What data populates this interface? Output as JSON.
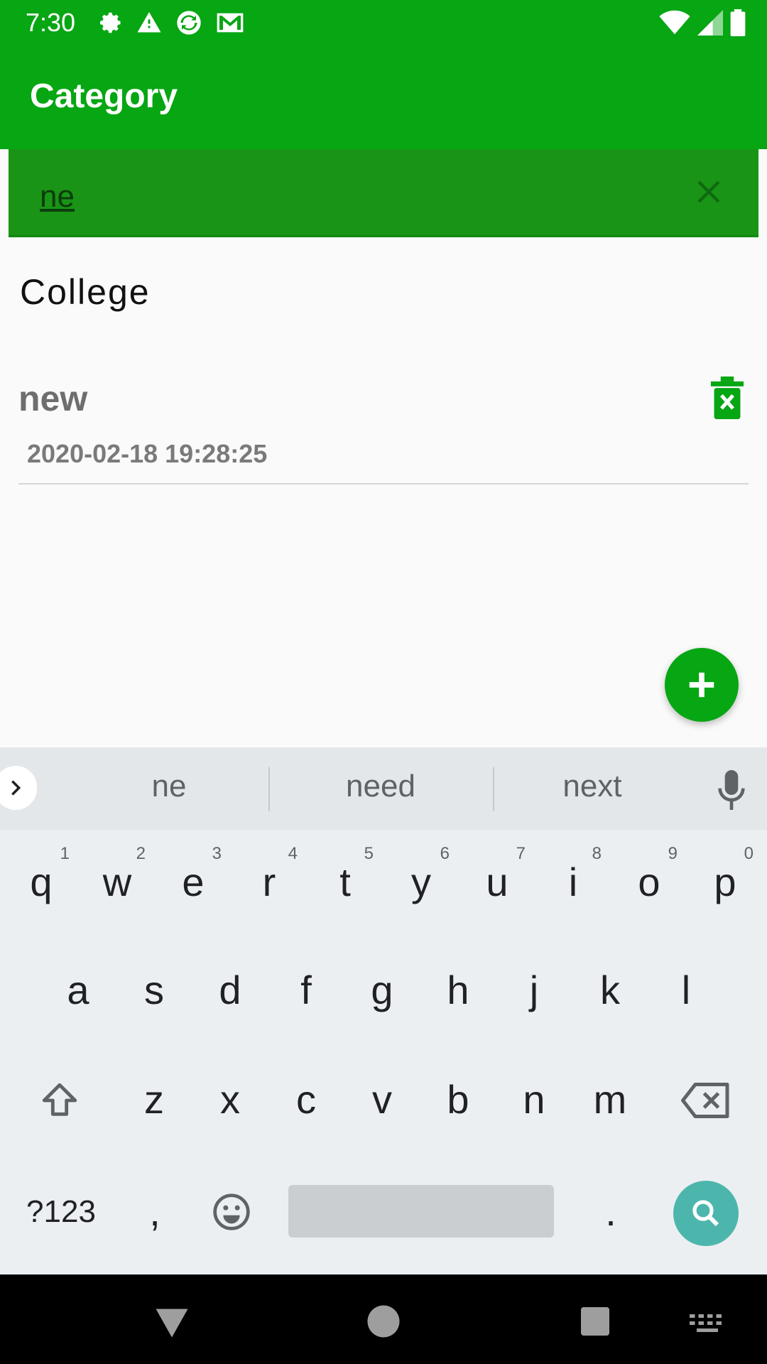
{
  "status_bar": {
    "time": "7:30",
    "left_icons": [
      "gear-icon",
      "warning-icon",
      "sync-icon",
      "gmail-icon"
    ],
    "right_icons": [
      "wifi-icon",
      "cellular-icon",
      "battery-icon"
    ]
  },
  "app_bar": {
    "title": "Category"
  },
  "search": {
    "value": "ne",
    "clear_icon": "close-icon"
  },
  "list": {
    "header": "College",
    "items": [
      {
        "title": "new",
        "date": "2020-02-18 19:28:25",
        "delete_icon": "delete-x-icon"
      }
    ]
  },
  "fab": {
    "icon": "plus-icon"
  },
  "keyboard": {
    "suggestions": [
      "ne",
      "need",
      "next"
    ],
    "row1": [
      {
        "key": "q",
        "hint": "1"
      },
      {
        "key": "w",
        "hint": "2"
      },
      {
        "key": "e",
        "hint": "3"
      },
      {
        "key": "r",
        "hint": "4"
      },
      {
        "key": "t",
        "hint": "5"
      },
      {
        "key": "y",
        "hint": "6"
      },
      {
        "key": "u",
        "hint": "7"
      },
      {
        "key": "i",
        "hint": "8"
      },
      {
        "key": "o",
        "hint": "9"
      },
      {
        "key": "p",
        "hint": "0"
      }
    ],
    "row2": [
      "a",
      "s",
      "d",
      "f",
      "g",
      "h",
      "j",
      "k",
      "l"
    ],
    "row3": [
      "z",
      "x",
      "c",
      "v",
      "b",
      "n",
      "m"
    ],
    "symbols_label": "?123",
    "comma": ",",
    "period": "."
  },
  "nav_bar": {
    "icons": [
      "back-icon",
      "home-icon",
      "recents-icon",
      "keyboard-switch-icon"
    ]
  }
}
